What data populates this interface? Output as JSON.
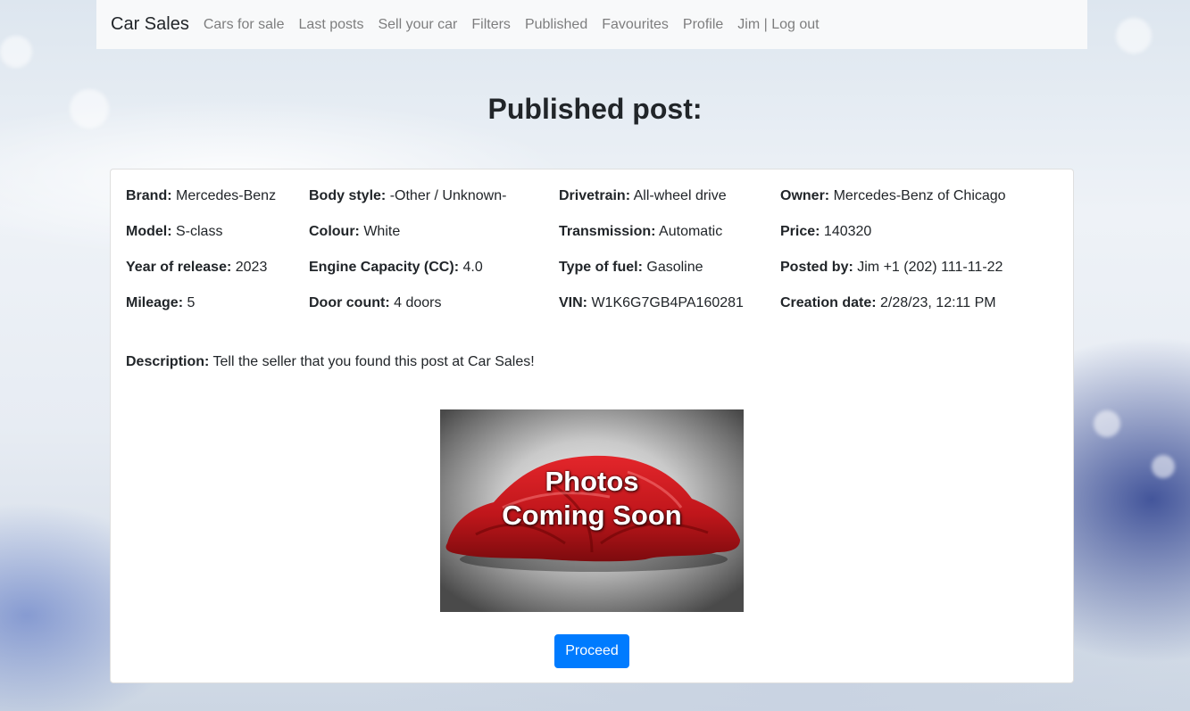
{
  "nav": {
    "brand": "Car Sales",
    "links": [
      "Cars for sale",
      "Last posts",
      "Sell your car",
      "Filters",
      "Published",
      "Favourites",
      "Profile",
      "Jim | Log out"
    ]
  },
  "page_title": "Published post:",
  "post": {
    "brand_label": "Brand:",
    "brand": "Mercedes-Benz",
    "model_label": "Model:",
    "model": "S-class",
    "year_label": "Year of release:",
    "year": "2023",
    "mileage_label": "Mileage:",
    "mileage": "5",
    "body_style_label": "Body style:",
    "body_style": "-Other / Unknown-",
    "colour_label": "Colour:",
    "colour": "White",
    "engine_label": "Engine Capacity (CC):",
    "engine": "4.0",
    "doors_label": "Door count:",
    "doors": "4 doors",
    "drivetrain_label": "Drivetrain:",
    "drivetrain": "All-wheel drive",
    "transmission_label": "Transmission:",
    "transmission": "Automatic",
    "fuel_label": "Type of fuel:",
    "fuel": "Gasoline",
    "vin_label": "VIN:",
    "vin": "W1K6G7GB4PA160281",
    "owner_label": "Owner:",
    "owner": "Mercedes-Benz of Chicago",
    "price_label": "Price:",
    "price": "140320",
    "posted_by_label": "Posted by:",
    "posted_by": "Jim +1 (202) 111-11-22",
    "creation_date_label": "Creation date:",
    "creation_date": "2/28/23, 12:11 PM",
    "description_label": "Description:",
    "description": "Tell the seller that you found this post at Car Sales!"
  },
  "photo": {
    "line1": "Photos",
    "line2": "Coming Soon",
    "icon": "covered-car-icon"
  },
  "proceed_label": "Proceed",
  "colors": {
    "primary": "#007bff",
    "navbar_bg": "#f8f9fa",
    "car_cover": "#c0161b"
  }
}
